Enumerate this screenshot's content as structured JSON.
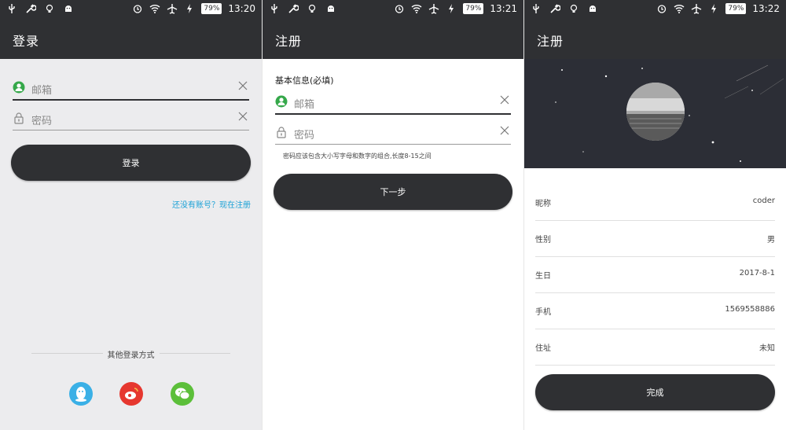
{
  "status": {
    "screens": [
      {
        "time": "13:20",
        "battery": "79%"
      },
      {
        "time": "13:21",
        "battery": "79%"
      },
      {
        "time": "13:22",
        "battery": "79%"
      }
    ]
  },
  "login": {
    "title": "登录",
    "email_placeholder": "邮箱",
    "password_placeholder": "密码",
    "login_button": "登录",
    "register_link": "还没有账号？现在注册",
    "other_methods": "其他登录方式",
    "social": [
      {
        "name": "qq",
        "color": "#3ab0e6"
      },
      {
        "name": "weibo",
        "color": "#e6372f"
      },
      {
        "name": "wechat",
        "color": "#5cbf3a"
      }
    ]
  },
  "register": {
    "title": "注册",
    "section": "基本信息(必填)",
    "email_placeholder": "邮箱",
    "password_placeholder": "密码",
    "hint": "密码应该包含大小写字母和数字的组合,长度8-15之间",
    "next_button": "下一步"
  },
  "profile": {
    "title": "注册",
    "rows": [
      {
        "label": "昵称",
        "value": "coder"
      },
      {
        "label": "性别",
        "value": "男"
      },
      {
        "label": "生日",
        "value": "2017-8-1"
      },
      {
        "label": "手机",
        "value": "1569558886"
      },
      {
        "label": "住址",
        "value": "未知"
      }
    ],
    "done_button": "完成"
  },
  "colors": {
    "bar": "#2f3033",
    "accent_green": "#35a84a",
    "link": "#1aa1d6"
  }
}
